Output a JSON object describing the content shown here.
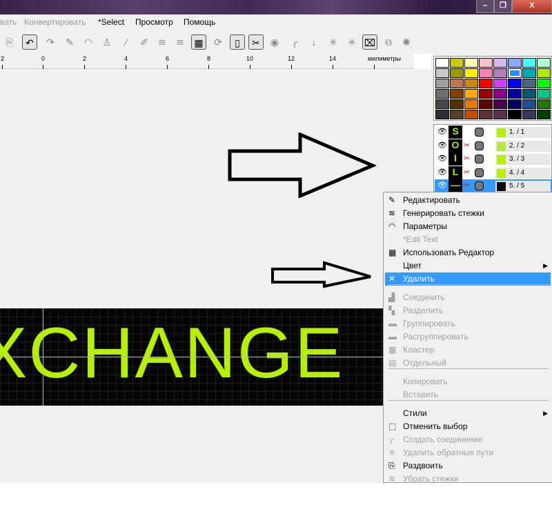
{
  "window": {
    "minimize": "–",
    "restore": "❐",
    "close": "X"
  },
  "menubar": {
    "items": [
      {
        "label": "вать",
        "disabled": true
      },
      {
        "label": "Конвертировать",
        "disabled": true
      },
      {
        "label": "*Select",
        "disabled": false
      },
      {
        "label": "Просмотр",
        "disabled": false
      },
      {
        "label": "Помощь",
        "disabled": false
      }
    ]
  },
  "ruler": {
    "labels": [
      "2",
      "0",
      "2",
      "4",
      "6",
      "8",
      "10",
      "12",
      "14"
    ],
    "unit": "милиметры"
  },
  "canvas": {
    "embroidery_text": "XCHANGE"
  },
  "palette": {
    "colors": [
      "#ffffff",
      "#cccc00",
      "#ffffb0",
      "#ffc0cb",
      "#d8b8f0",
      "#88aaff",
      "#40ffff",
      "#a8ffd0",
      "#c8c8c8",
      "#999900",
      "#ffee00",
      "#ff80b0",
      "#b080b8",
      "#1e90ff",
      "#00a8b8",
      "#b0e800",
      "#a0a0a0",
      "#c07850",
      "#cc8800",
      "#ff0000",
      "#d040ff",
      "#0000ff",
      "#486880",
      "#00ff00",
      "#707070",
      "#804000",
      "#ffaa00",
      "#a00000",
      "#880088",
      "#0000a0",
      "#005870",
      "#00c880",
      "#484848",
      "#583000",
      "#f07800",
      "#600000",
      "#480048",
      "#000060",
      "#205090",
      "#207800",
      "#303030",
      "#584028",
      "#c05000",
      "#603030",
      "#583050",
      "#000000",
      "#383858",
      "#004000"
    ],
    "selected": "#1e90ff"
  },
  "layers": [
    {
      "label": "1.  / 1",
      "color": "#b6f000",
      "glyph": "S"
    },
    {
      "label": "2.  / 2",
      "color": "#b8e840",
      "glyph": "O"
    },
    {
      "label": "3.  / 3",
      "color": "#b6f000",
      "glyph": "I"
    },
    {
      "label": "4.  / 4",
      "color": "#b6f000",
      "glyph": "L"
    },
    {
      "label": "5.  / 5",
      "color": "#0a0a0a",
      "glyph": "—",
      "selected": true
    }
  ],
  "context_menu": {
    "items": [
      {
        "label": "Редактировать",
        "icon": "✎"
      },
      {
        "label": "Генерировать стежки",
        "icon": "≋"
      },
      {
        "label": "Параметры",
        "icon": "◠"
      },
      {
        "label": "*Edit Text",
        "disabled": true
      },
      {
        "label": "Использовать Редактор",
        "icon": "▦"
      },
      {
        "label": "Цвет",
        "submenu": true
      },
      {
        "label": "Удалить",
        "icon": "✕",
        "highlighted": true
      },
      {
        "label": "Соединить",
        "icon": "▟",
        "disabled": true
      },
      {
        "label": "Разделить",
        "icon": "▚",
        "disabled": true
      },
      {
        "label": "Группировать",
        "icon": "▬",
        "disabled": true
      },
      {
        "label": "Расгруппировать",
        "icon": "▬",
        "disabled": true
      },
      {
        "label": "Кластер",
        "icon": "▦",
        "disabled": true
      },
      {
        "label": "Отдельный",
        "icon": "▤",
        "disabled": true
      },
      {
        "label": "Копировать",
        "disabled": true
      },
      {
        "label": "Вставить",
        "disabled": true
      },
      {
        "label": "Стили",
        "submenu": true
      },
      {
        "label": "Отменить выбор",
        "icon": "⬚"
      },
      {
        "label": "Создать соединение",
        "icon": "╭",
        "disabled": true
      },
      {
        "label": "Удалить обратные пути",
        "icon": "✳",
        "disabled": true
      },
      {
        "label": "Раздвоить",
        "icon": "⎘"
      },
      {
        "label": "Убрать стежки",
        "icon": "≋",
        "disabled": true
      }
    ]
  }
}
